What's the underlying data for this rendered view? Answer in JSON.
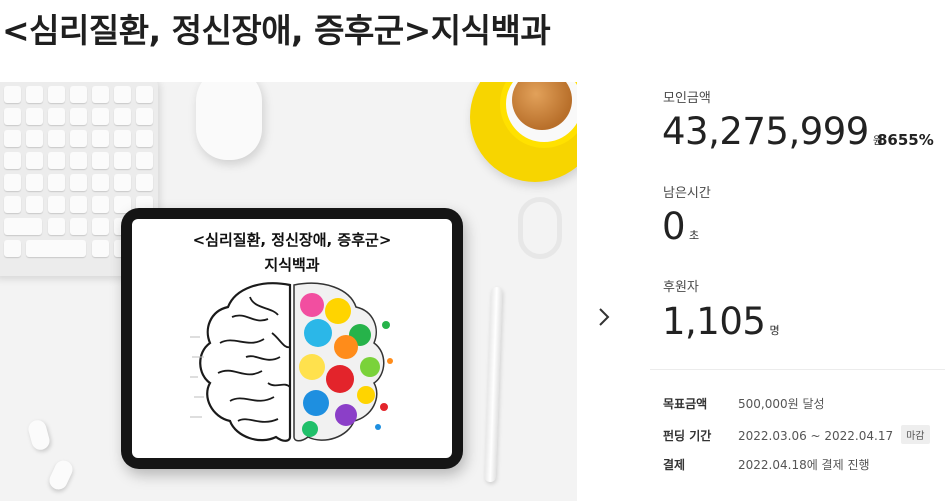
{
  "page": {
    "title": "<심리질환, 정신장애, 증후군>지식백과"
  },
  "hero": {
    "screen_line1": "<심리질환, 정신장애, 증후군>",
    "screen_line2": "지식백과",
    "next_icon": "chevron-right-icon"
  },
  "stats": {
    "amount": {
      "label": "모인금액",
      "value": "43,275,999",
      "unit": "원",
      "rate": "8655%"
    },
    "time_left": {
      "label": "남은시간",
      "value": "0",
      "unit": "초"
    },
    "backers": {
      "label": "후원자",
      "value": "1,105",
      "unit": "명"
    }
  },
  "info": {
    "goal": {
      "key": "목표금액",
      "value": "500,000원 달성"
    },
    "period": {
      "key": "펀딩 기간",
      "value": "2022.03.06 ~ 2022.04.17",
      "badge": "마감"
    },
    "payment": {
      "key": "결제",
      "value": "2022.04.18에 결제 진행"
    }
  },
  "colors": {
    "text": "#222222",
    "accent_yellow": "#f7d500",
    "badge_bg": "#eeeeee"
  }
}
